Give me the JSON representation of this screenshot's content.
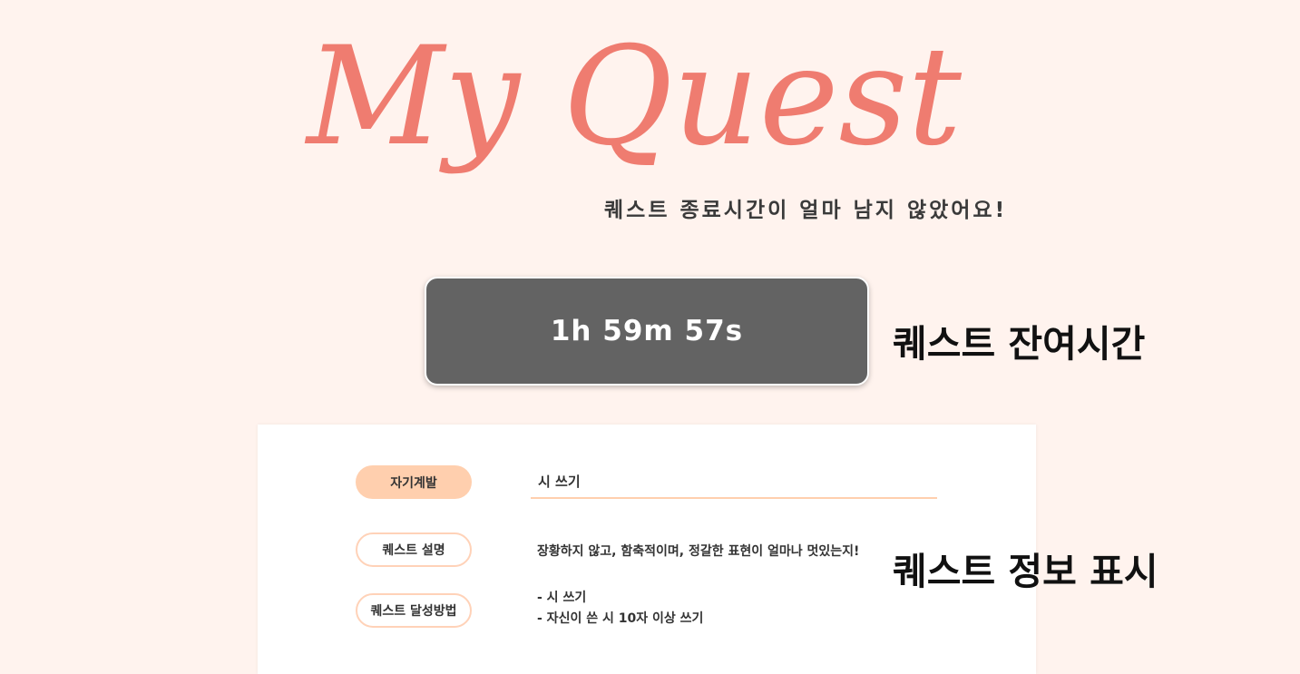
{
  "header": {
    "logo_text": "My Quest",
    "subtitle": "퀘스트 종료시간이 얼마 남지 않았어요!"
  },
  "timer": {
    "remaining": "1h 59m 57s",
    "annotation": "퀘스트 잔여시간"
  },
  "quest": {
    "category": "자기계발",
    "title": "시 쓰기",
    "description_label": "퀘스트 설명",
    "description": "장황하지 않고, 함축적이며, 정갈한 표현이 얼마나 멋있는지!",
    "method_label": "퀘스트 달성방법",
    "methods": [
      "- 시 쓰기",
      "- 자신이 쓴 시 10자 이상 쓰기"
    ],
    "annotation": "퀘스트 정보 표시"
  },
  "colors": {
    "background": "#fff3ee",
    "logo": "#ef7c70",
    "timer_bg": "#636363",
    "accent": "#ffcfae"
  }
}
